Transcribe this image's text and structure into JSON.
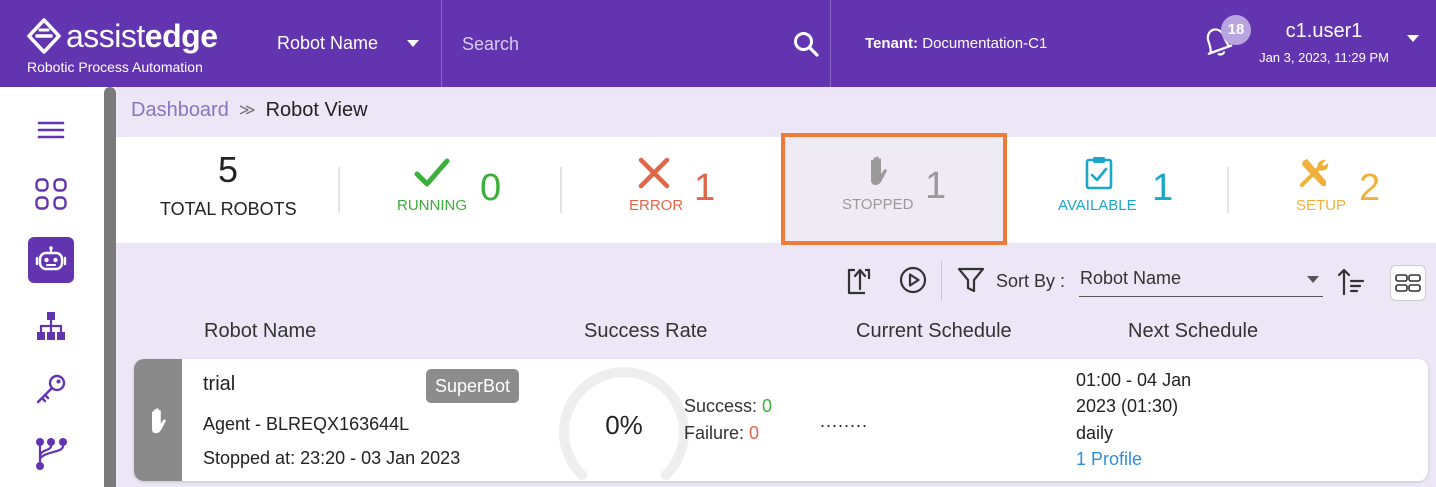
{
  "header": {
    "logo_part1": "assist",
    "logo_part2": "edge",
    "logo_subtitle": "Robotic Process Automation",
    "robot_name_dropdown": "Robot Name",
    "search_placeholder": "Search",
    "tenant_label": "Tenant:",
    "tenant_value": "Documentation-C1",
    "notification_count": "18",
    "username": "c1.user1",
    "datetime": "Jan 3, 2023, 11:29 PM"
  },
  "sidebar": {
    "items": [
      {
        "name": "menu",
        "icon": "hamburger-icon",
        "active": false
      },
      {
        "name": "dashboard",
        "icon": "grid-icon",
        "active": false
      },
      {
        "name": "robots",
        "icon": "robot-icon",
        "active": true
      },
      {
        "name": "hierarchy",
        "icon": "org-chart-icon",
        "active": false
      },
      {
        "name": "keys",
        "icon": "key-icon",
        "active": false
      },
      {
        "name": "workflow",
        "icon": "flow-icon",
        "active": false
      }
    ]
  },
  "breadcrumb": {
    "parent": "Dashboard",
    "separator": "≫",
    "current": "Robot View"
  },
  "stats": {
    "total": {
      "value": "5",
      "label": "TOTAL ROBOTS"
    },
    "running": {
      "value": "0",
      "label": "RUNNING",
      "color": "#3cae3c"
    },
    "error": {
      "value": "1",
      "label": "ERROR",
      "color": "#e0664a"
    },
    "stopped": {
      "value": "1",
      "label": "STOPPED",
      "color": "#9a9a9a"
    },
    "available": {
      "value": "1",
      "label": "AVAILABLE",
      "color": "#1ba8c8"
    },
    "setup": {
      "value": "2",
      "label": "SETUP",
      "color": "#f0b13c"
    }
  },
  "toolbar": {
    "sort_label": "Sort By :",
    "sort_value": "Robot Name"
  },
  "columns": [
    "Robot Name",
    "Success Rate",
    "Current Schedule",
    "Next Schedule"
  ],
  "robot": {
    "name": "trial",
    "tag": "SuperBot",
    "agent": "Agent - BLREQX163644L",
    "stopped_at": "Stopped at: 23:20 - 03 Jan 2023",
    "success_rate": "0%",
    "success_label": "Success:",
    "success_value": "0",
    "failure_label": "Failure:",
    "failure_value": "0",
    "current_schedule": "........",
    "next_schedule_line1": "01:00 - 04 Jan",
    "next_schedule_line2": "2023 (01:30)",
    "next_schedule_line3": "daily",
    "profile_link": "1 Profile"
  },
  "colors": {
    "brand": "#6334b0",
    "highlight": "#ef7b3b",
    "link": "#2f8fd6"
  }
}
